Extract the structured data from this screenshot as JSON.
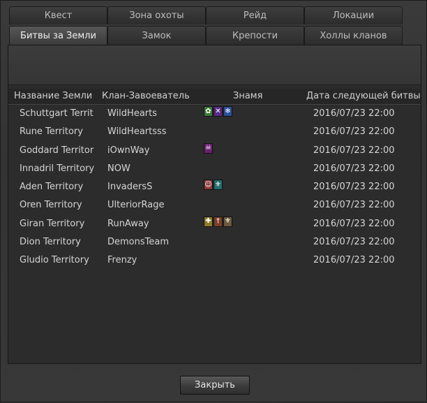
{
  "tabs_back": [
    "Квест",
    "Зона охоты",
    "Рейд",
    "Локации"
  ],
  "tabs_front": [
    "Битвы за Земли",
    "Замок",
    "Крепости",
    "Холлы кланов"
  ],
  "active_tab": "Битвы за Земли",
  "columns": {
    "land": "Название Земли",
    "clan": "Клан-Завоеватель",
    "flag": "Знамя",
    "date": "Дата следующей битвы"
  },
  "rows": [
    {
      "land": "Schuttgart Territ",
      "clan": "WildHearts",
      "date": "2016/07/23 22:00",
      "flags": [
        {
          "icon": "leaf-emblem-icon",
          "color": "#3f7a3a",
          "glyph": "✿"
        },
        {
          "icon": "crossed-swords-icon",
          "color": "#5b2a86",
          "glyph": "✕"
        },
        {
          "icon": "snowflake-icon",
          "color": "#2a4f9a",
          "glyph": "❄"
        }
      ]
    },
    {
      "land": "Rune Territory",
      "clan": "WildHeartsss",
      "date": "2016/07/23 22:00",
      "flags": []
    },
    {
      "land": "Goddard Territor",
      "clan": "iOwnWay",
      "date": "2016/07/23 22:00",
      "flags": [
        {
          "icon": "skull-icon",
          "color": "#6a1f6e",
          "glyph": "☠"
        }
      ]
    },
    {
      "land": "Innadril Territory",
      "clan": "NOW",
      "date": "2016/07/23 22:00",
      "flags": []
    },
    {
      "land": "Aden Territory",
      "clan": "InvadersS",
      "date": "2016/07/23 22:00",
      "flags": [
        {
          "icon": "mask-icon",
          "color": "#8a3a3a",
          "glyph": "☺"
        },
        {
          "icon": "fleur-icon",
          "color": "#236d6d",
          "glyph": "⚜"
        }
      ]
    },
    {
      "land": "Oren Territory",
      "clan": "UlteriorRage",
      "date": "2016/07/23 22:00",
      "flags": []
    },
    {
      "land": "Giran Territory",
      "clan": "RunAway",
      "date": "2016/07/23 22:00",
      "flags": [
        {
          "icon": "cross-icon",
          "color": "#8a7a2a",
          "glyph": "✚"
        },
        {
          "icon": "sword-icon",
          "color": "#7a3f2a",
          "glyph": "†"
        },
        {
          "icon": "wings-icon",
          "color": "#6b5a3a",
          "glyph": "⚜"
        }
      ]
    },
    {
      "land": "Dion Territory",
      "clan": "DemonsTeam",
      "date": "2016/07/23 22:00",
      "flags": []
    },
    {
      "land": "Gludio Territory",
      "clan": "Frenzy",
      "date": "2016/07/23 22:00",
      "flags": []
    }
  ],
  "close_button": "Закрыть"
}
